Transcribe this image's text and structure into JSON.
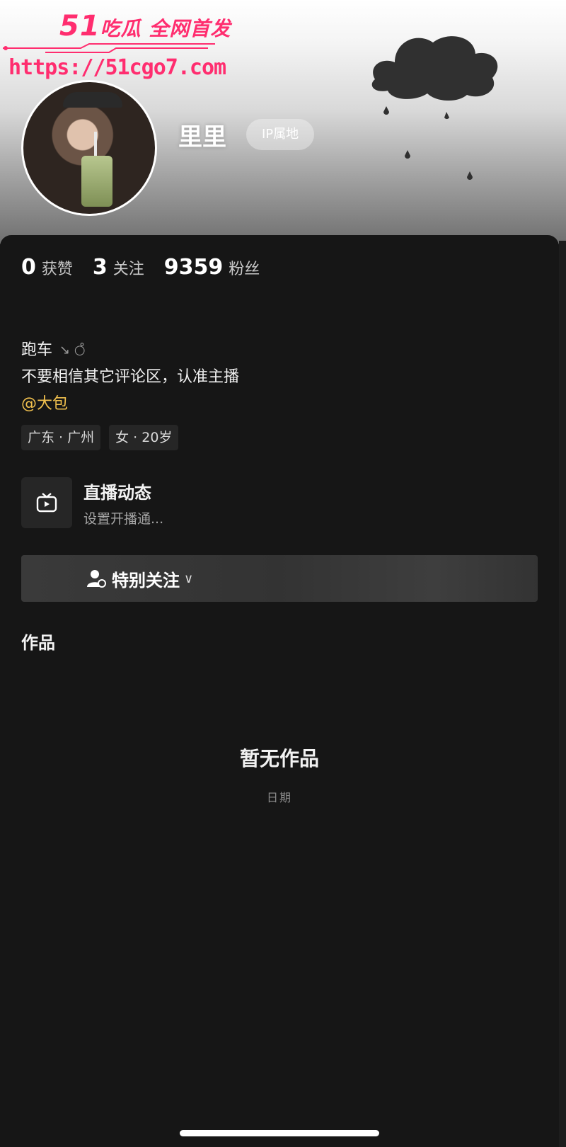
{
  "watermark": {
    "logo_number": "51",
    "logo_text": "吃瓜 全网首发",
    "url": "https://51cgo7.com",
    "color": "#ff2d6f"
  },
  "profile": {
    "nickname": "里里",
    "ip_badge": "IP属地",
    "avatar_icon": "user-avatar-photo"
  },
  "stats": [
    {
      "value": "0",
      "label": "获赞"
    },
    {
      "value": "3",
      "label": "关注"
    },
    {
      "value": "9359",
      "label": "粉丝"
    }
  ],
  "bio": {
    "line1": "跑车",
    "line1_symbols": "↘ ○̊",
    "line2": "不要相信其它评论区，认准主播",
    "mention": "@大包",
    "mention_color": "#f2c14e"
  },
  "tags": [
    "广东 · 广州",
    "女 · 20岁"
  ],
  "live": {
    "icon": "tv-icon",
    "title": "直播动态",
    "subtitle": "设置开播通..."
  },
  "follow": {
    "icon": "user-follow-icon",
    "label": "特别关注",
    "chevron": "chevron-down-icon"
  },
  "works": {
    "title": "作品",
    "empty_title": "暂无作品",
    "empty_sub": "日期"
  }
}
